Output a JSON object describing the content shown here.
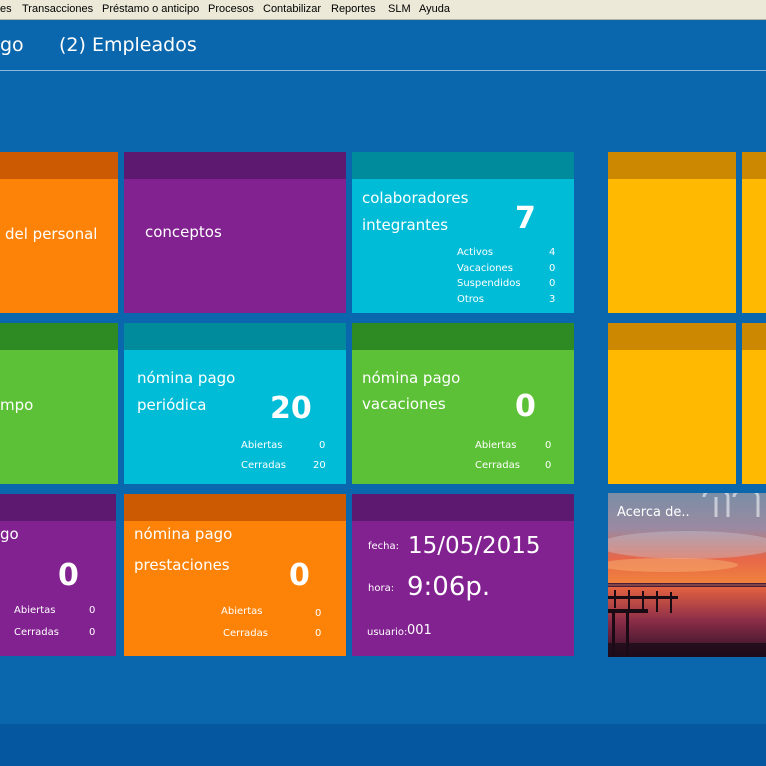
{
  "menu": [
    "es",
    "Transacciones",
    "Préstamo o anticipo",
    "Procesos",
    "Contabilizar",
    "Reportes",
    "SLM",
    "Ayuda"
  ],
  "header": {
    "title_left": "go",
    "title_main": "(2) Empleados"
  },
  "tiles": {
    "personal": {
      "label": "del personal",
      "color": "#fd8308",
      "band": "#cc5a03"
    },
    "conceptos": {
      "label": "conceptos",
      "color": "#822190",
      "band": "#5d1870"
    },
    "colaboradores": {
      "label1": "colaboradores",
      "label2": "integrantes",
      "count": "7",
      "rows": [
        {
          "label": "Activos",
          "value": "4"
        },
        {
          "label": "Vacaciones",
          "value": "0"
        },
        {
          "label": "Suspendidos",
          "value": "0"
        },
        {
          "label": "Otros",
          "value": "3"
        }
      ],
      "color": "#00bcd7",
      "band": "#008b9c"
    },
    "tiempo": {
      "label": "mpo",
      "color": "#5cc136",
      "band": "#2e8b24"
    },
    "periodica": {
      "label1": "nómina pago",
      "label2": "periódica",
      "count": "20",
      "rows": [
        {
          "label": "Abiertas",
          "value": "0"
        },
        {
          "label": "Cerradas",
          "value": "20"
        }
      ],
      "color": "#00bcd7",
      "band": "#008b9c"
    },
    "vacaciones": {
      "label1": "nómina pago",
      "label2": "vacaciones",
      "count": "0",
      "rows": [
        {
          "label": "Abiertas",
          "value": "0"
        },
        {
          "label": "Cerradas",
          "value": "0"
        }
      ],
      "color": "#5cc136",
      "band": "#2e8b24"
    },
    "left_bottom": {
      "label1": "go",
      "count": "0",
      "rows": [
        {
          "label": "Abiertas",
          "value": "0"
        },
        {
          "label": "Cerradas",
          "value": "0"
        }
      ],
      "color": "#822190",
      "band": "#5d1870"
    },
    "prestaciones": {
      "label1": "nómina pago",
      "label2": "prestaciones",
      "count": "0",
      "rows": [
        {
          "label": "Abiertas",
          "value": "0"
        },
        {
          "label": "Cerradas",
          "value": "0"
        }
      ],
      "color": "#fd8308",
      "band": "#cc5a03"
    },
    "info": {
      "fecha_label": "fecha:",
      "fecha": "15/05/2015",
      "hora_label": "hora:",
      "hora": "9:06p.",
      "usuario_label": "usuario:",
      "usuario": "001",
      "color": "#822190",
      "band": "#5d1870"
    },
    "yellow": {
      "color": "#ffb900",
      "band": "#cc8800"
    },
    "acerca": {
      "label": "Acerca de.."
    }
  }
}
